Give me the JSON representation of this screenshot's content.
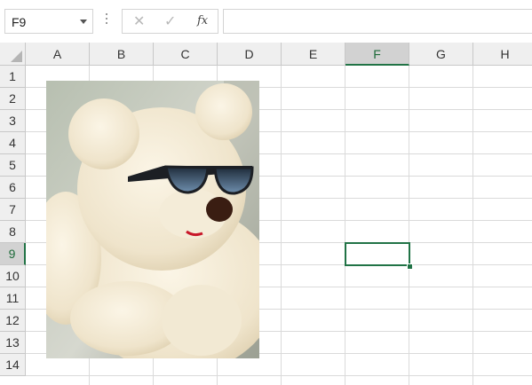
{
  "formula_bar": {
    "name_box_value": "F9",
    "cancel_icon": "✕",
    "enter_icon": "✓",
    "function_icon": "fx",
    "formula_value": ""
  },
  "sheet": {
    "columns": [
      "A",
      "B",
      "C",
      "D",
      "E",
      "F",
      "G",
      "H"
    ],
    "rows": [
      "1",
      "2",
      "3",
      "4",
      "5",
      "6",
      "7",
      "8",
      "9",
      "10",
      "11",
      "12",
      "13",
      "14"
    ],
    "active_cell": "F9",
    "accent_color": "#217346"
  },
  "picture": {
    "subject": "teddy-bear-with-sunglasses"
  }
}
